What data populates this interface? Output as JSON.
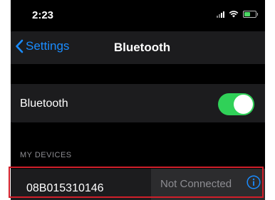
{
  "status_bar": {
    "time": "2:23",
    "signal_icon": "cellular-signal-icon",
    "wifi_icon": "wifi-icon",
    "battery_icon": "battery-icon",
    "battery_level": 0.5
  },
  "nav": {
    "back_label": "Settings",
    "back_icon": "chevron-left-icon",
    "title": "Bluetooth"
  },
  "bluetooth": {
    "label": "Bluetooth",
    "enabled": true
  },
  "my_devices": {
    "header": "MY DEVICES",
    "devices": [
      {
        "name": "08B015310146",
        "status": "Not Connected",
        "info_icon": "info-icon"
      }
    ]
  },
  "colors": {
    "background": "#000000",
    "cell": "#1c1c1e",
    "accent": "#1a8cff",
    "toggle_on": "#30d158",
    "highlight": "#d01f2a",
    "secondary_text": "#8d8d92"
  }
}
